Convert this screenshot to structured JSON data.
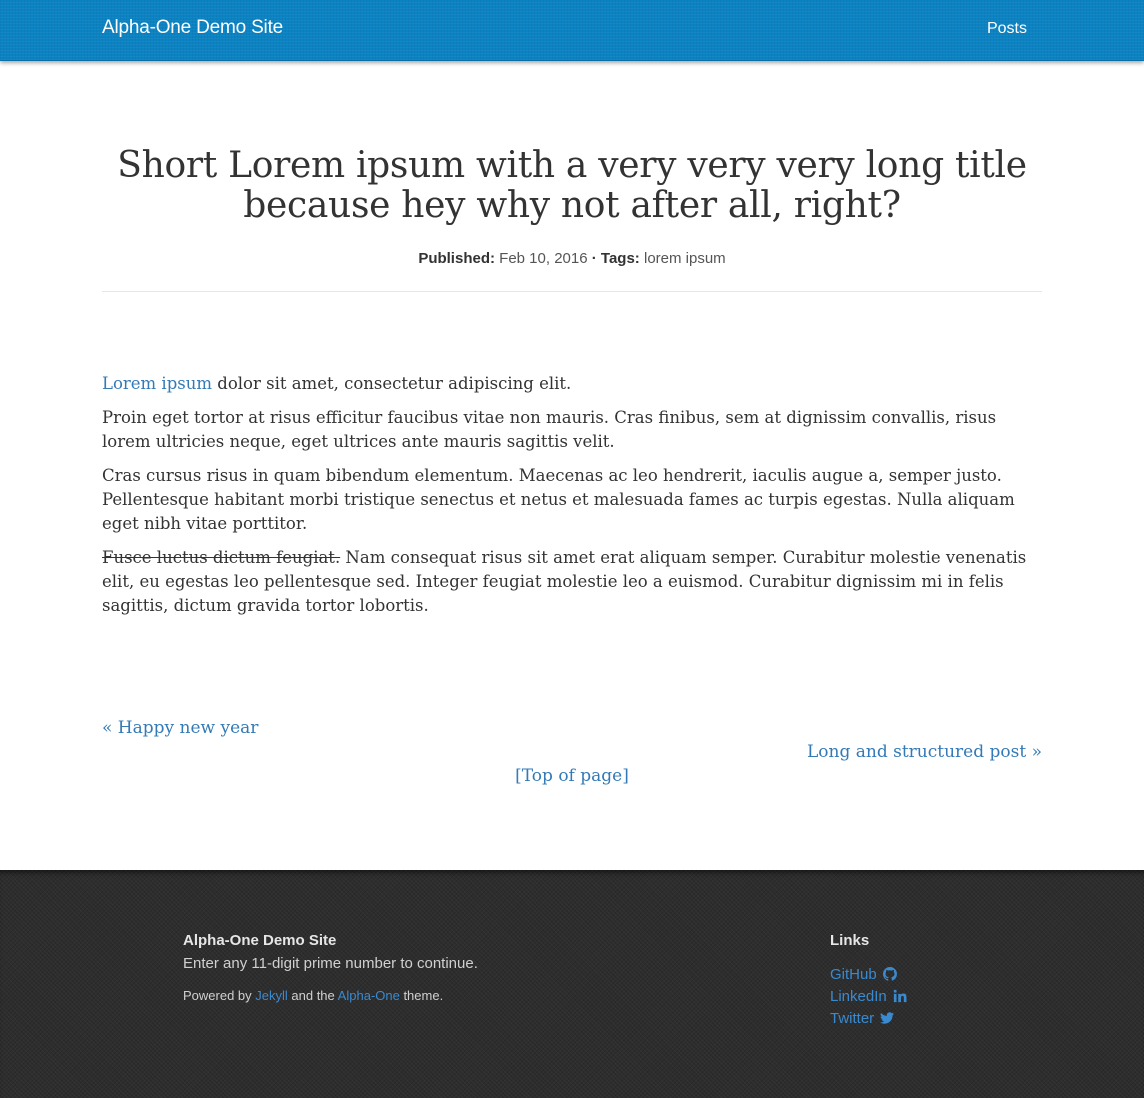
{
  "navbar": {
    "brand": "Alpha-One Demo Site",
    "links": [
      {
        "label": "Posts"
      }
    ]
  },
  "post": {
    "title": "Short Lorem ipsum with a very very very long title because hey why not after all, right?",
    "meta": {
      "published_label": "Published:",
      "date": "Feb 10, 2016",
      "separator": "·",
      "tags_label": "Tags:",
      "tags": "lorem ipsum"
    },
    "paragraphs": {
      "p1_link": "Lorem ipsum",
      "p1_rest": " dolor sit amet, consectetur adipiscing elit.",
      "p2": "Proin eget tortor at risus efficitur faucibus vitae non mauris. Cras finibus, sem at dignissim convallis, risus lorem ultricies neque, eget ultrices ante mauris sagittis velit.",
      "p3": "Cras cursus risus in quam bibendum elementum. Maecenas ac leo hendrerit, iaculis augue a, semper justo. Pellentesque habitant morbi tristique senectus et netus et malesuada fames ac turpis egestas. Nulla aliquam eget nibh vitae porttitor.",
      "p4_strike": "Fusce luctus dictum feugiat.",
      "p4_rest": " Nam consequat risus sit amet erat aliquam semper. Curabitur molestie venenatis elit, eu egestas leo pellentesque sed. Integer feugiat molestie leo a euismod. Curabitur dignissim mi in felis sagittis, dictum gravida tortor lobortis."
    }
  },
  "pager": {
    "prev": "« Happy new year",
    "next": "Long and structured post »",
    "top": "[Top of page]"
  },
  "footer": {
    "site_name": "Alpha-One Demo Site",
    "tagline": "Enter any 11-digit prime number to continue.",
    "powered_prefix": "Powered by ",
    "powered_link1": "Jekyll",
    "powered_middle": " and the ",
    "powered_link2": "Alpha-One",
    "powered_suffix": " theme.",
    "links_heading": "Links",
    "links": [
      {
        "label": "GitHub",
        "icon": "github-icon"
      },
      {
        "label": "LinkedIn",
        "icon": "linkedin-icon"
      },
      {
        "label": "Twitter",
        "icon": "twitter-icon"
      }
    ]
  },
  "colors": {
    "navbar": "#0b82c2",
    "link": "#337ab7",
    "footer_bg": "#2d2d2d",
    "footer_link": "#3a8ad0"
  }
}
